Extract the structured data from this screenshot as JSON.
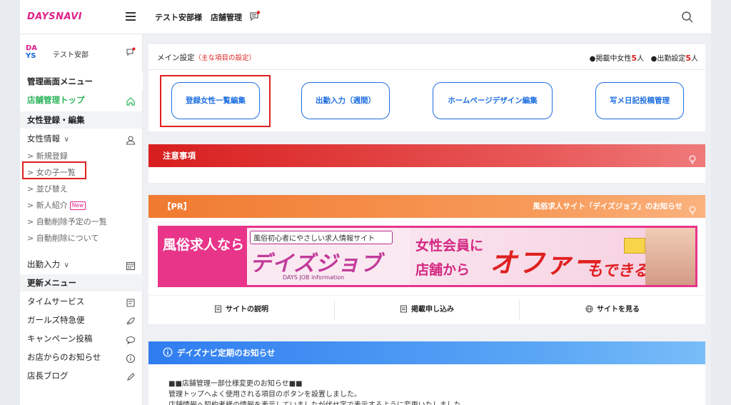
{
  "header": {
    "logo": "DAYSNAVI",
    "user": "テスト安部様",
    "shop": "店舗管理",
    "menu_icon": "hamburger-icon",
    "chat_icon": "chat-icon",
    "search_icon": "search-icon"
  },
  "sidebar": {
    "avatar_line1": "DA",
    "avatar_line2": "YS",
    "username": "テスト安部",
    "menu_title": "管理画面メニュー",
    "shop_top": "店舗管理トップ",
    "section_girls": "女性登録・編集",
    "girl_info": "女性情報",
    "girl_info_chevron": "∨",
    "sub_items": [
      "新規登録",
      "女の子一覧",
      "並び替え",
      "新人紹介",
      "自動削除予定の一覧",
      "自動削除について"
    ],
    "new_badge": "New",
    "attendance": "出勤入力",
    "attendance_chevron": "∨",
    "update_menu": "更新メニュー",
    "update_items": [
      "タイムサービス",
      "ガールズ特急便",
      "キャンペーン投稿",
      "お店からのお知らせ",
      "店長ブログ"
    ]
  },
  "main": {
    "settings_title": "メイン設定",
    "settings_note": "（主な項目の設定）",
    "stat1_label": "●掲載中女性",
    "stat1_num": "5",
    "stat1_unit": "人",
    "stat2_label": "●出勤設定",
    "stat2_num": "5",
    "stat2_unit": "人",
    "buttons": [
      "登録女性一覧編集",
      "出勤入力（週間）",
      "ホームページデザイン編集",
      "写メ日記投稿管理"
    ],
    "caution_title": "注意事項",
    "pr_title": "【PR】",
    "pr_sub": "風俗求人サイト「デイズジョブ」のお知らせ",
    "ad": {
      "left": "風俗求人なら",
      "mid_top": "風俗初心者にやさしい求人情報サイト",
      "mid_logo": "デイズジョブ",
      "mid_sub": "DAYS JOB information",
      "line1": "女性会員に",
      "line2": "店舗から",
      "offer": "オファー",
      "can": "もできる!!"
    },
    "pr_links": [
      "サイトの説明",
      "掲載申し込み",
      "サイトを見る"
    ],
    "notice_title": "デイズナビ定期のお知らせ",
    "notice_lines": [
      "■■店舗管理一部仕様変更のお知らせ■■",
      "管理トップへよく使用される項目のボタンを設置しました。",
      "店舗情報へ契約者様の情報を表示していましたが伏せ字で表示するように変更いたしました。"
    ]
  },
  "colors": {
    "accent_blue": "#1e6fe0",
    "brand_pink": "#e0218a",
    "green": "#2bb55a",
    "alert_red": "#e02020",
    "caution_bar": "#d81e1e",
    "pr_bar": "#f07a30",
    "notice_bar": "#2f7cf0"
  }
}
